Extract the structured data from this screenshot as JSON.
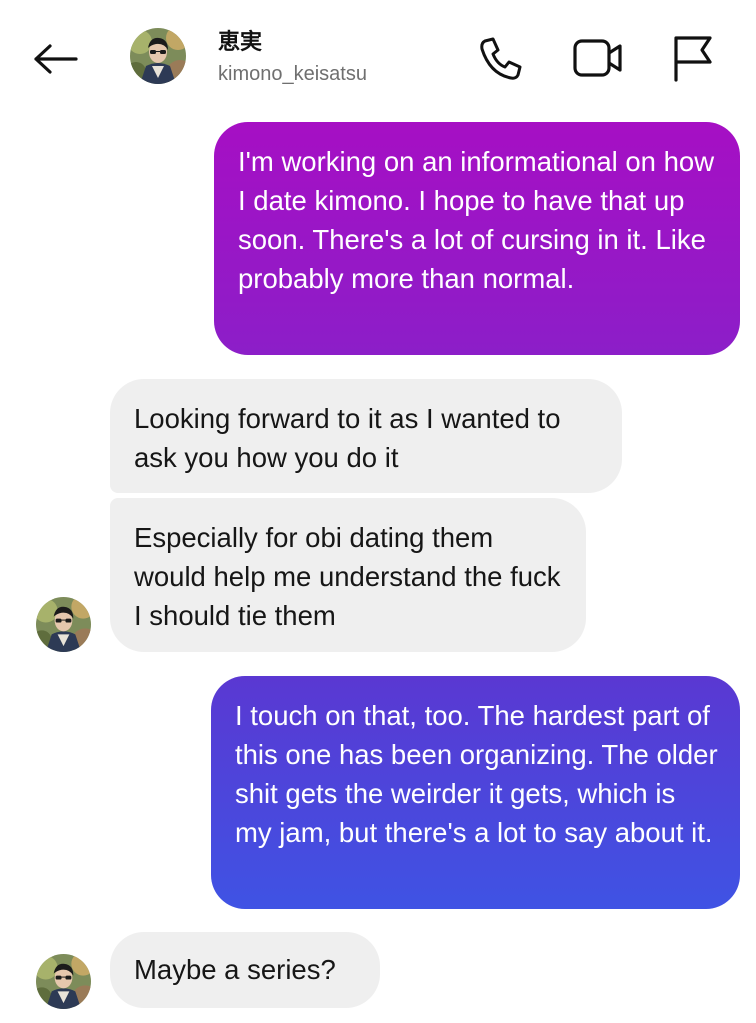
{
  "header": {
    "display_name": "恵実",
    "username": "kimono_keisatsu",
    "back_icon": "arrow-left-icon",
    "call_icon": "phone-icon",
    "video_icon": "video-camera-icon",
    "report_icon": "flag-icon"
  },
  "messages": [
    {
      "sender": "me",
      "text": "I'm working on an informational on how I date kimono. I hope to have that up soon. There's a lot of cursing in it. Like probably more than normal."
    },
    {
      "sender": "them",
      "text": "Looking forward to it as I wanted to ask you how you do it"
    },
    {
      "sender": "them",
      "text": "Especially for obi dating them would help me understand the fuck I should tie them"
    },
    {
      "sender": "me",
      "text": "I touch on that, too. The hardest part of this one has been organizing. The older shit gets the weirder it gets, which is my jam, but there's a lot to say about it."
    },
    {
      "sender": "them",
      "text": "Maybe a series?"
    }
  ],
  "colors": {
    "outgoing_1_top": "#a60fc4",
    "outgoing_2_bottom": "#3f53e4",
    "incoming_bg": "#efefef",
    "username_gray": "#6f6f6f"
  }
}
